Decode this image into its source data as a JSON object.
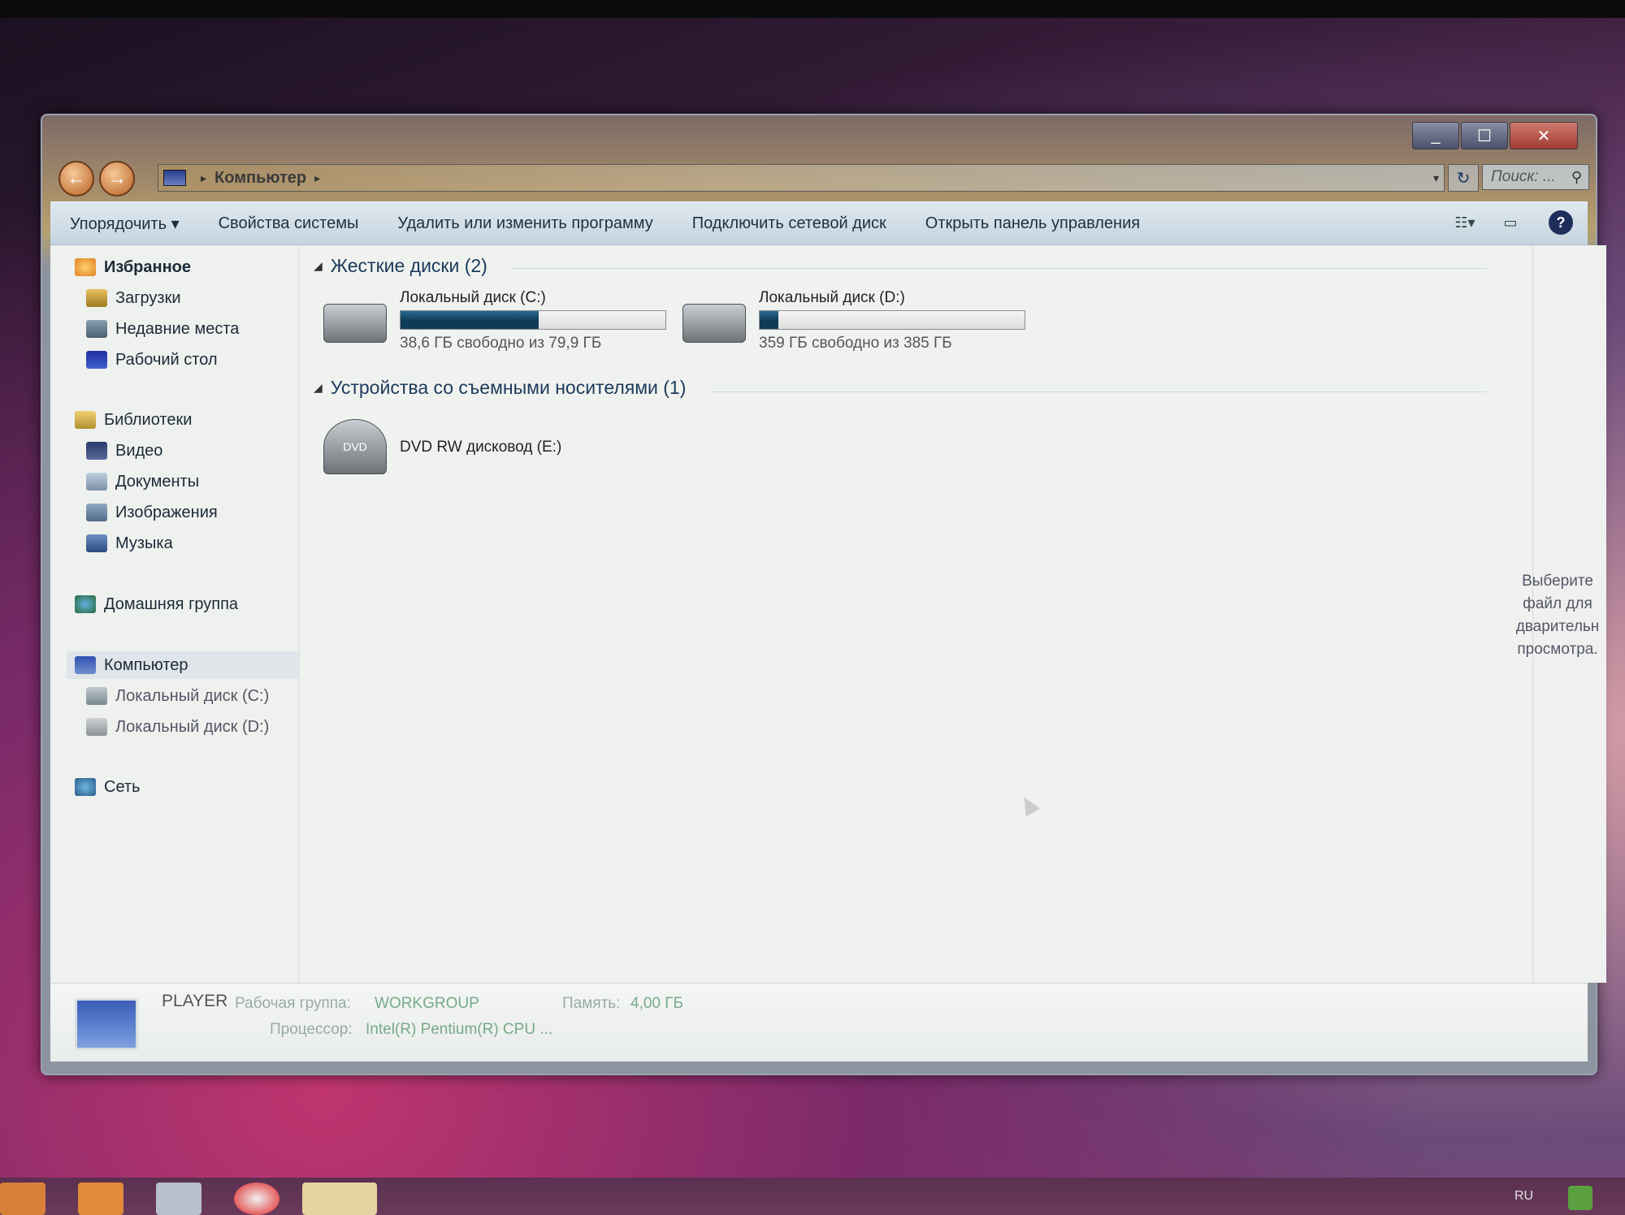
{
  "window": {
    "buttons": {
      "minimize": "_",
      "maximize": "☐",
      "close": "✕"
    }
  },
  "navbar": {
    "back_icon": "←",
    "forward_icon": "→",
    "breadcrumb": "Компьютер",
    "breadcrumb_sep": "▸",
    "dropdown": "▾",
    "refresh": "↻",
    "search_placeholder": "Поиск: ...",
    "search_icon": "⚲"
  },
  "toolbar": {
    "organize": "Упорядочить ▾",
    "system_properties": "Свойства системы",
    "uninstall": "Удалить или изменить программу",
    "map_drive": "Подключить сетевой диск",
    "control_panel": "Открыть панель управления",
    "help": "?"
  },
  "sidebar": {
    "favorites": "Избранное",
    "downloads": "Загрузки",
    "recent": "Недавние места",
    "desktop": "Рабочий стол",
    "libraries": "Библиотеки",
    "video": "Видео",
    "documents": "Документы",
    "images": "Изображения",
    "music": "Музыка",
    "homegroup": "Домашняя группа",
    "computer": "Компьютер",
    "disk_c": "Локальный диск (C:)",
    "disk_d": "Локальный диск (D:)",
    "network": "Сеть"
  },
  "content": {
    "hdd_group": "Жесткие диски (2)",
    "removable_group": "Устройства со съемными носителями (1)",
    "drives": [
      {
        "name": "Локальный диск (C:)",
        "free": "38,6 ГБ свободно из 79,9 ГБ",
        "used_fraction": 0.52
      },
      {
        "name": "Локальный диск (D:)",
        "free": "359 ГБ свободно из 385 ГБ",
        "used_fraction": 0.07
      }
    ],
    "dvd": {
      "name": "DVD RW дисковод (E:)",
      "badge": "DVD"
    }
  },
  "preview": {
    "text": "Выберите файл для дварительн просмотра."
  },
  "details": {
    "pc_name": "PLAYER",
    "workgroup_label": "Рабочая группа:",
    "workgroup": "WORKGROUP",
    "memory_label": "Память:",
    "memory": "4,00 ГБ",
    "cpu_label": "Процессор:",
    "cpu": "Intel(R) Pentium(R) CPU ..."
  },
  "tray": {
    "lang": "RU"
  },
  "colors": {
    "bar_fill": "#0d3852",
    "link_blue": "#1c3a5a"
  }
}
